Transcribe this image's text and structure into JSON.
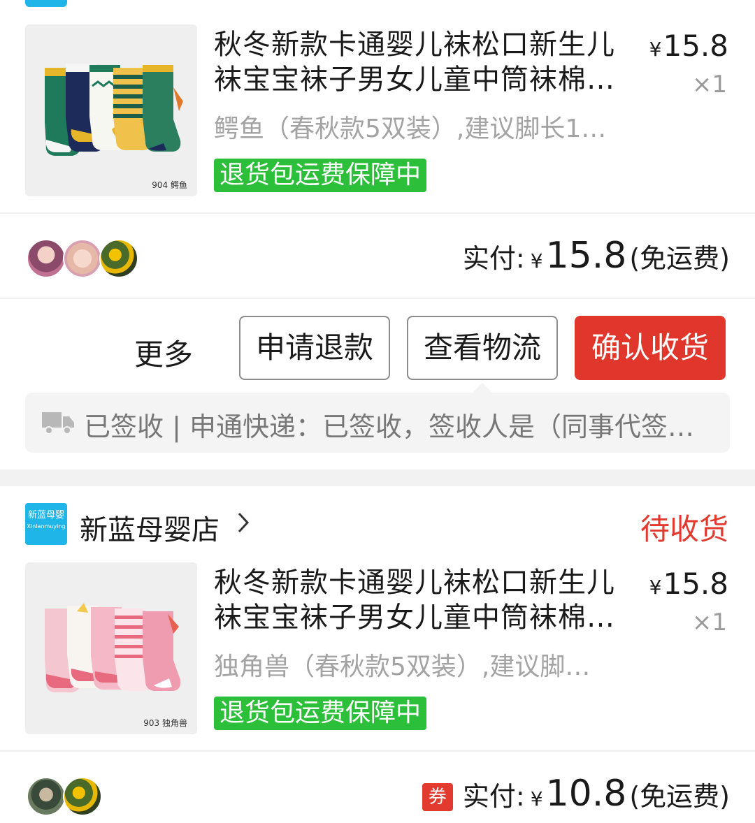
{
  "colors": {
    "accent_red": "#e0362c",
    "guarantee_green": "#2bbf3a",
    "shop_logo_blue": "#1fb5e8"
  },
  "order1": {
    "product": {
      "title": "秋冬新款卡通婴儿袜松口新生儿袜宝宝袜子男女儿童中筒袜棉…",
      "price_symbol": "¥",
      "price": "15.8",
      "qty": "×1",
      "sku": "鳄鱼（春秋款5双装）,建议脚长1…",
      "guarantee": "退货包运费保障中",
      "image_tag": "904 鳄鱼"
    },
    "payment": {
      "label": "实付:",
      "symbol": "¥",
      "amount": "15.8",
      "shipping": "(免运费)"
    },
    "actions": {
      "more": "更多",
      "refund": "申请退款",
      "logistics": "查看物流",
      "confirm": "确认收货"
    },
    "logistics_info": {
      "icon": "truck-icon",
      "text": "已签收 | 申通快递：已签收，签收人是（同事代签…"
    }
  },
  "order2": {
    "shop": {
      "logo_line1": "新蓝母婴",
      "logo_line2": "Xinlanmuying",
      "name": "新蓝母婴店",
      "status": "待收货"
    },
    "product": {
      "title": "秋冬新款卡通婴儿袜松口新生儿袜宝宝袜子男女儿童中筒袜棉…",
      "price_symbol": "¥",
      "price": "15.8",
      "qty": "×1",
      "sku": "独角兽（春秋款5双装）,建议脚…",
      "guarantee": "退货包运费保障中",
      "image_tag": "903 独角兽"
    },
    "payment": {
      "coupon": "券",
      "label": "实付:",
      "symbol": "¥",
      "amount": "10.8",
      "shipping": "(免运费)"
    }
  }
}
